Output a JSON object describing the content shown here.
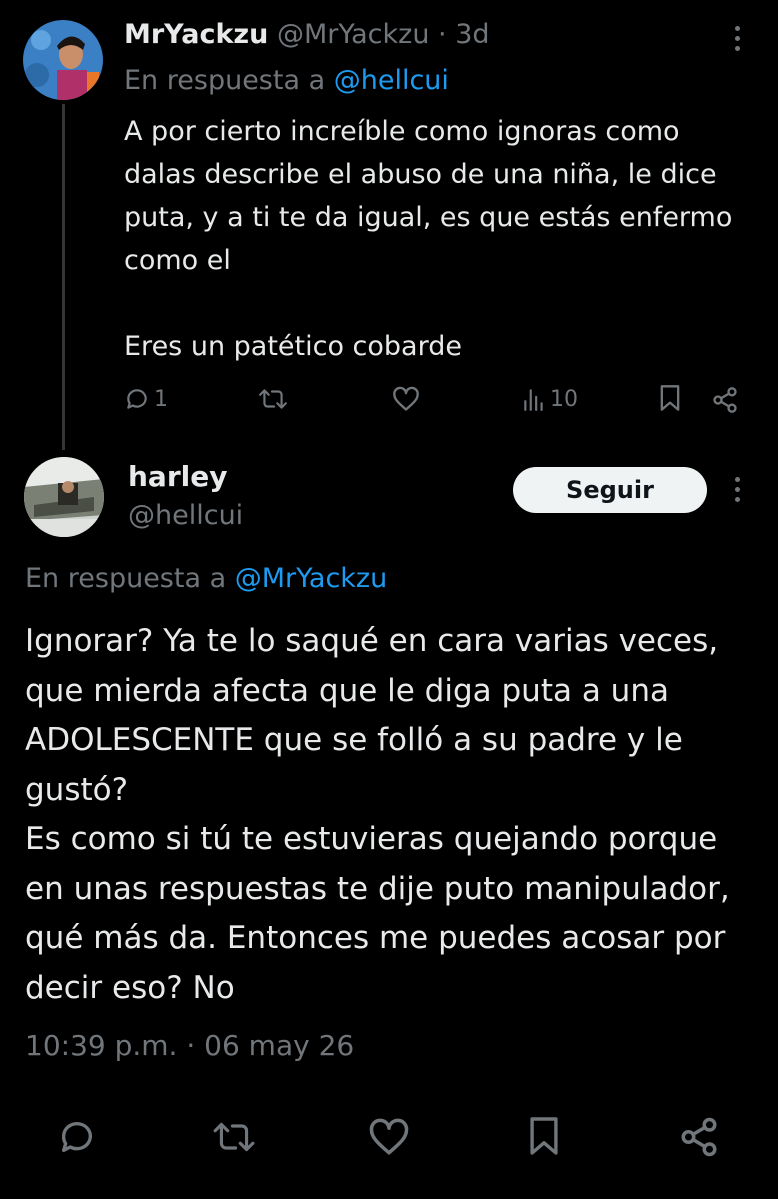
{
  "reply_tweet": {
    "display_name": "MrYackzu",
    "handle": "@MrYackzu",
    "separator": "·",
    "age": "3d",
    "replying_to_prefix": "En respuesta a",
    "replying_to_handle": "@hellcui",
    "text": "A por cierto increíble como ignoras como dalas describe el abuso de una niña, le dice puta, y a ti te da igual, es que estás enfermo como el\n\nEres un patético cobarde",
    "stats": {
      "replies": "1",
      "views": "10"
    }
  },
  "main_tweet": {
    "display_name": "harley",
    "handle": "@hellcui",
    "follow_label": "Seguir",
    "replying_to_prefix": "En respuesta a",
    "replying_to_handle": "@MrYackzu",
    "text": "Ignorar? Ya te lo saqué en cara varias veces, que mierda afecta que le diga puta a una ADOLESCENTE que se folló a su padre y le gustó?\nEs como si tú te estuvieras quejando porque en unas respuestas te dije puto manipulador, qué más da. Entonces me puedes acosar por decir eso? No",
    "timestamp": "10:39 p.m. · 06 may 26"
  },
  "icons": [
    "reply-icon",
    "retweet-icon",
    "like-icon",
    "views-icon",
    "bookmark-icon",
    "share-icon",
    "more-icon"
  ],
  "colors": {
    "background": "#000000",
    "text": "#e7e9ea",
    "muted": "#71767b",
    "link": "#1d9bf0",
    "follow_bg": "#eff3f4"
  }
}
